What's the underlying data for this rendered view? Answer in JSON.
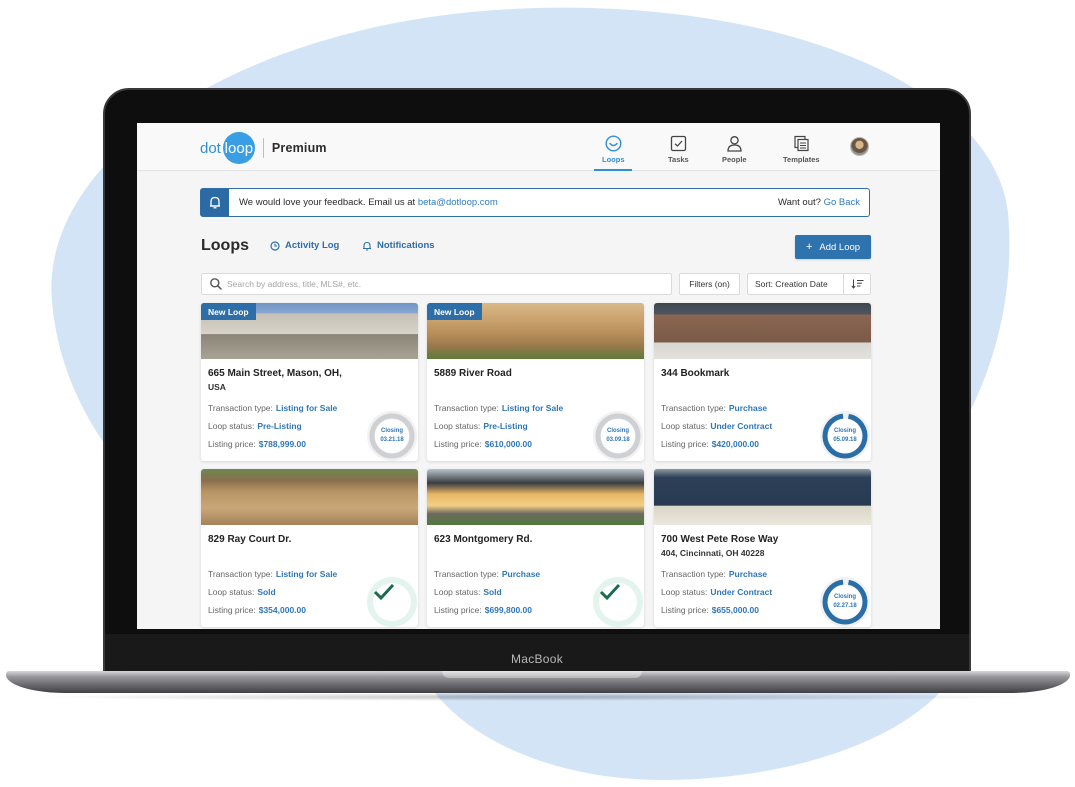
{
  "device": {
    "label": "MacBook"
  },
  "app": {
    "logo": {
      "dot": "dot",
      "loop": "loop"
    },
    "plan": "Premium",
    "brand_color": "#3a9ee4",
    "accent_color": "#2e73ad"
  },
  "nav": [
    {
      "label": "Loops",
      "icon": "loop-smile-icon",
      "active": true
    },
    {
      "label": "Tasks",
      "icon": "checkbox-icon",
      "active": false
    },
    {
      "label": "People",
      "icon": "person-icon",
      "active": false
    },
    {
      "label": "Templates",
      "icon": "templates-icon",
      "active": false
    }
  ],
  "banner": {
    "message": "We would love your feedback. Email us at ",
    "email": "beta@dotloop.com",
    "want_out": "Want out? ",
    "go_back": "Go Back"
  },
  "page": {
    "title": "Loops",
    "activity_log": "Activity Log",
    "notifications": "Notifications",
    "add_loop": "Add Loop"
  },
  "toolbar": {
    "search_placeholder": "Search by address, title, MLS#, etc.",
    "filters": "Filters (on)",
    "sort": "Sort: Creation Date"
  },
  "labels": {
    "transaction_type": "Transaction type:",
    "loop_status": "Loop status:",
    "listing_price": "Listing price:",
    "closing": "Closing"
  },
  "loops": [
    {
      "badge": "New Loop",
      "address": "665 Main Street, Mason, OH,",
      "address2": "USA",
      "transaction_type": "Listing for Sale",
      "status": "Pre-Listing",
      "price": "$788,999.00",
      "closing": "03.21.18",
      "indicator": "pending"
    },
    {
      "badge": "New Loop",
      "address": "5889 River Road",
      "address2": "",
      "transaction_type": "Listing for Sale",
      "status": "Pre-Listing",
      "price": "$610,000.00",
      "closing": "03.09.18",
      "indicator": "pending"
    },
    {
      "badge": "",
      "address": "344 Bookmark",
      "address2": "",
      "transaction_type": "Purchase",
      "status": "Under Contract",
      "price": "$420,000.00",
      "closing": "05.09.18",
      "indicator": "contract"
    },
    {
      "badge": "",
      "address": "829 Ray Court Dr.",
      "address2": "",
      "transaction_type": "Listing for Sale",
      "status": "Sold",
      "price": "$354,000.00",
      "closing": "",
      "indicator": "sold"
    },
    {
      "badge": "",
      "address": "623 Montgomery Rd.",
      "address2": "",
      "transaction_type": "Purchase",
      "status": "Sold",
      "price": "$699,800.00",
      "closing": "",
      "indicator": "sold"
    },
    {
      "badge": "",
      "address": "700 West Pete Rose Way",
      "address2": "404, Cincinnati, OH 40228",
      "transaction_type": "Purchase",
      "status": "Under Contract",
      "price": "$655,000.00",
      "closing": "02.27.18",
      "indicator": "contract"
    }
  ]
}
